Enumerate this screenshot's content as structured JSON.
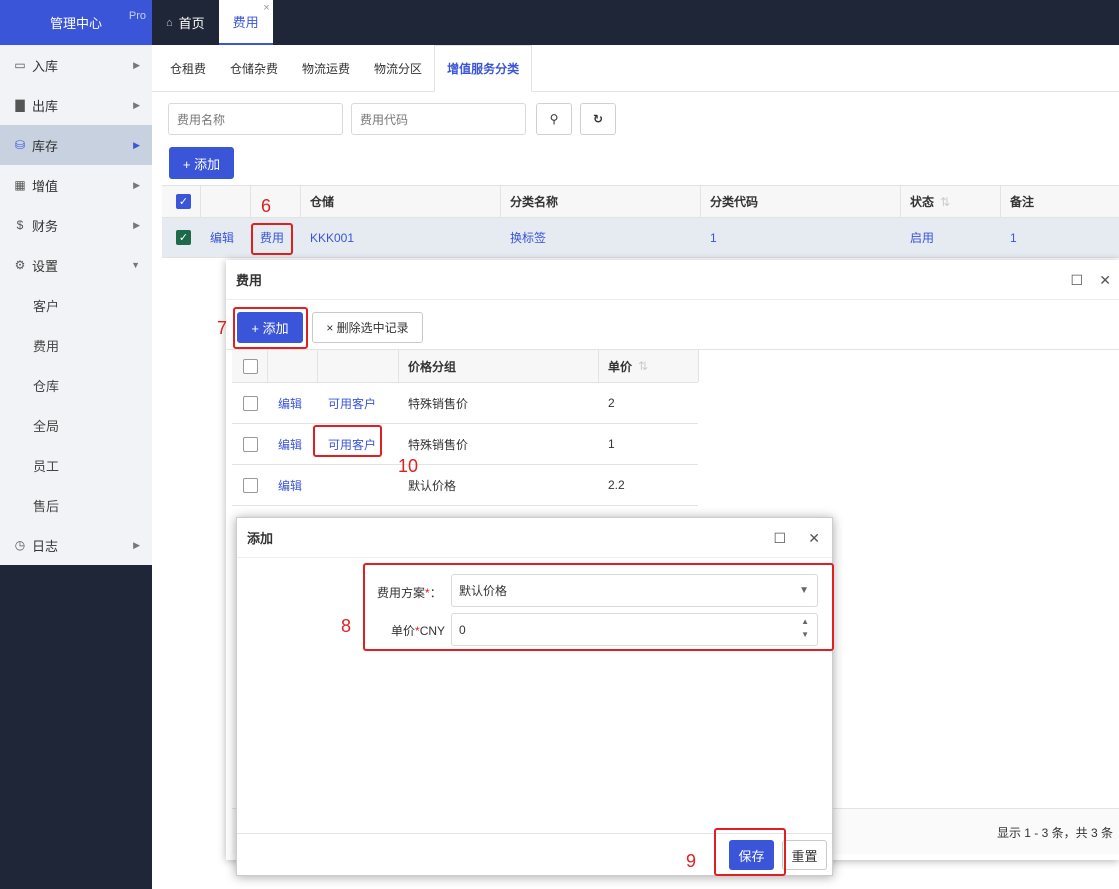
{
  "brand": {
    "title": "管理中心",
    "badge": "Pro"
  },
  "topbar": {
    "home_tab": "首页",
    "active_tab": "费用",
    "close_glyph": "×"
  },
  "sidebar": {
    "items": [
      {
        "label": "入库",
        "icon": "inbox-icon",
        "glyph": "▭"
      },
      {
        "label": "出库",
        "icon": "truck-icon",
        "glyph": "▇"
      },
      {
        "label": "库存",
        "icon": "cubes-icon",
        "glyph": "⛁"
      },
      {
        "label": "增值",
        "icon": "grid-icon",
        "glyph": "▦"
      },
      {
        "label": "财务",
        "icon": "dollar-icon",
        "glyph": "$"
      },
      {
        "label": "设置",
        "icon": "gears-icon",
        "glyph": "⚙"
      }
    ],
    "sub_items": [
      "客户",
      "费用",
      "仓库",
      "全局",
      "员工",
      "售后"
    ],
    "log_item": {
      "label": "日志",
      "icon": "clock-icon",
      "glyph": "◷"
    }
  },
  "subtabs": [
    "仓租费",
    "仓储杂费",
    "物流运费",
    "物流分区",
    "增值服务分类"
  ],
  "search": {
    "name_placeholder": "费用名称",
    "code_placeholder": "费用代码"
  },
  "toolbar": {
    "add_label": "+ 添加"
  },
  "main_table": {
    "headers": {
      "warehouse": "仓储",
      "category_name": "分类名称",
      "category_code": "分类代码",
      "status": "状态",
      "remark": "备注"
    },
    "row": {
      "edit": "编辑",
      "fee": "费用",
      "warehouse": "KKK001",
      "category_name": "换标签",
      "category_code": "1",
      "status": "启用",
      "remark": "1"
    }
  },
  "dialog_fee": {
    "title": "费用",
    "add_label": "+ 添加",
    "delete_label": "× 删除选中记录",
    "headers": {
      "price_group": "价格分组",
      "unit_price": "单价"
    },
    "rows": [
      {
        "edit": "编辑",
        "customers": "可用客户",
        "price_group": "特殊销售价",
        "unit_price": "2"
      },
      {
        "edit": "编辑",
        "customers": "可用客户",
        "price_group": "特殊销售价",
        "unit_price": "1"
      },
      {
        "edit": "编辑",
        "customers": "",
        "price_group": "默认价格",
        "unit_price": "2.2"
      }
    ],
    "pagination": "显示 1 - 3 条，共 3 条"
  },
  "dialog_add": {
    "title": "添加",
    "scheme_label": "费用方案",
    "scheme_value": "默认价格",
    "price_label_prefix": "单价",
    "price_label_suffix": "CNY",
    "price_value": "0",
    "required_mark": "*",
    "colon": "：",
    "save_label": "保存",
    "reset_label": "重置"
  },
  "annotations": [
    "6",
    "7",
    "8",
    "9",
    "10"
  ],
  "colors": {
    "accent": "#3a55d8",
    "sidebar_dark": "#1f2637",
    "annotation_red": "#e02020"
  }
}
